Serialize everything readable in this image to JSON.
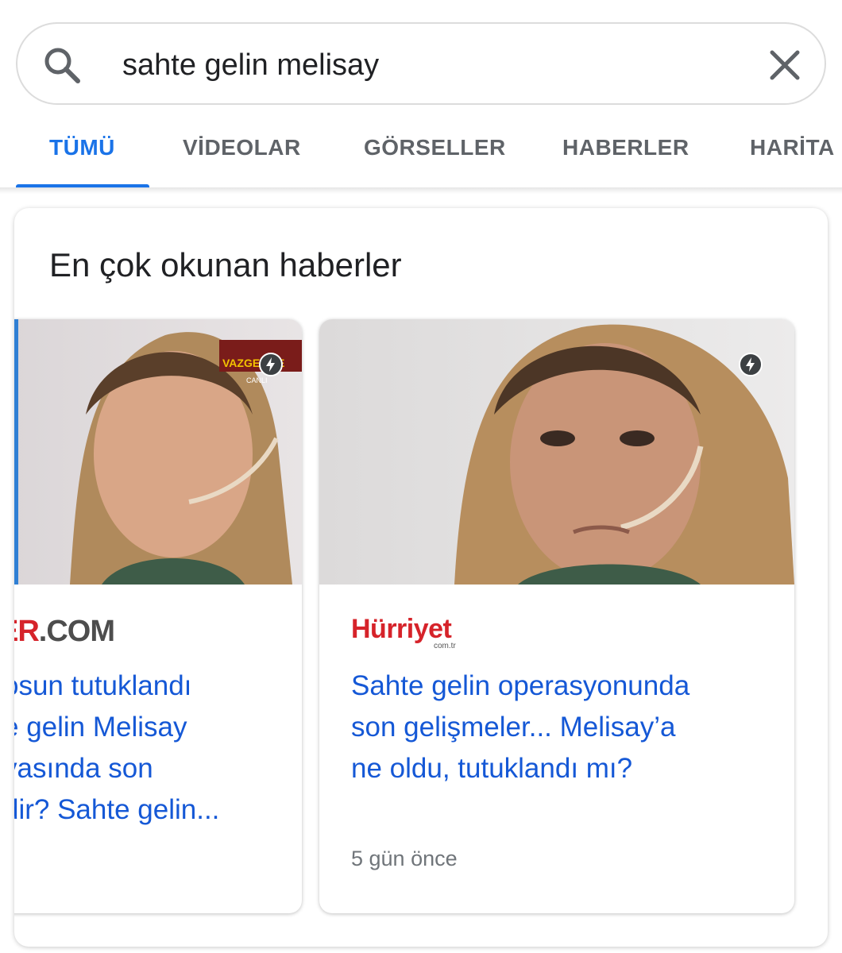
{
  "search": {
    "query": "sahte gelin melisay",
    "search_icon": "search-icon",
    "clear_icon": "close-icon"
  },
  "tabs": [
    {
      "label": "TÜMÜ",
      "active": true
    },
    {
      "label": "VİDEOLAR",
      "active": false
    },
    {
      "label": "GÖRSELLER",
      "active": false
    },
    {
      "label": "HABERLER",
      "active": false
    },
    {
      "label": "HARİTA",
      "active": false
    }
  ],
  "section": {
    "title": "En çok okunan haberler"
  },
  "cards": [
    {
      "source_logo_red": "ER",
      "source_logo_grey": ".COM",
      "headline_lines": [
        "osun tutuklandı",
        "e gelin Melisay",
        "vasında son",
        "dir? Sahte gelin..."
      ],
      "image_overlay_lines": [
        "VAZGEÇME",
        "CANLI"
      ],
      "amp_icon": "lightning-icon"
    },
    {
      "source_name": "Hürriyet",
      "source_sub": "com.tr",
      "headline_lines": [
        "Sahte gelin operasyonunda",
        "son gelişmeler... Melisay’a",
        "ne oldu, tutuklandı mı?"
      ],
      "time": "5 gün önce",
      "amp_icon": "lightning-icon"
    }
  ],
  "colors": {
    "accent": "#1a73e8",
    "link": "#1558d6",
    "muted": "#5f6368",
    "brand_red": "#d6232a"
  }
}
